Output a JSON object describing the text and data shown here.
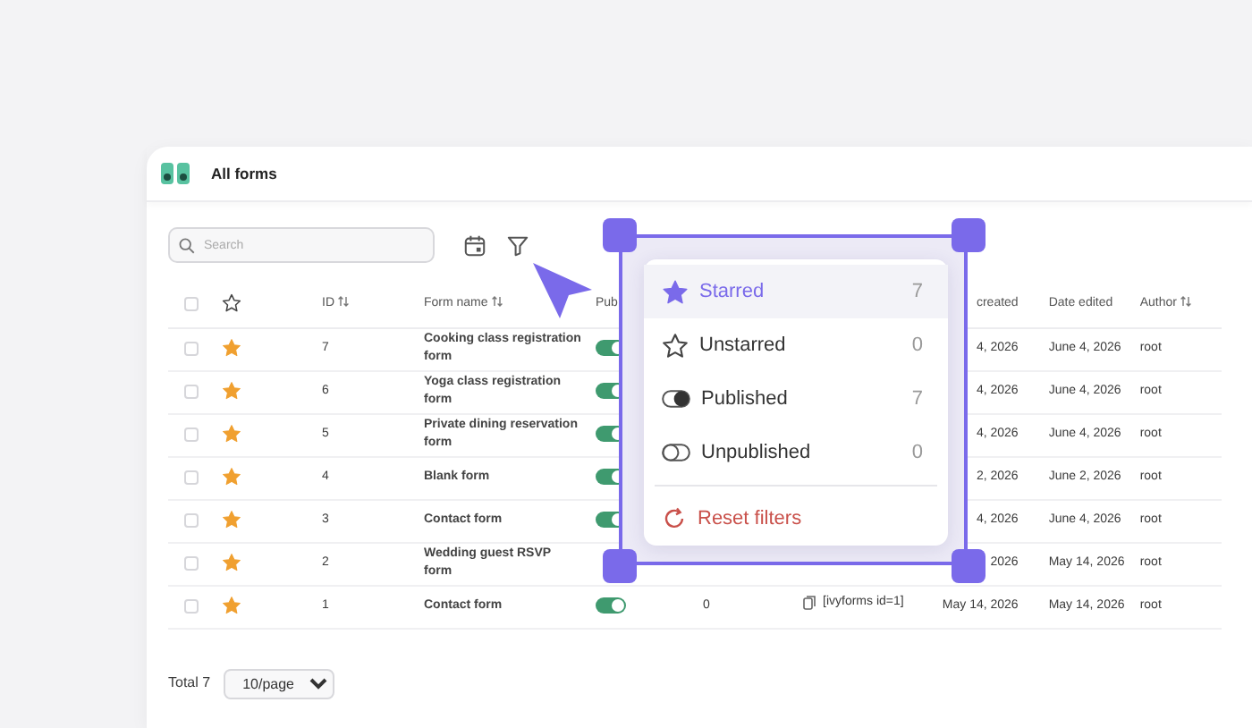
{
  "header": {
    "title": "All forms"
  },
  "toolbar": {
    "search": {
      "placeholder": "Search"
    }
  },
  "table": {
    "columns": [
      {
        "kind": "checkbox",
        "checked": false
      },
      {
        "kind": "star"
      },
      {
        "kind": "text",
        "label": "ID",
        "sortable": true
      },
      {
        "kind": "text",
        "label": "Form name",
        "sortable": true
      },
      {
        "kind": "text",
        "label": "Pub"
      },
      {
        "kind": "blank"
      },
      {
        "kind": "blank"
      },
      {
        "kind": "text",
        "label": "created"
      },
      {
        "kind": "text",
        "label": "Date edited"
      },
      {
        "kind": "text",
        "label": "Author",
        "sortable": true
      }
    ],
    "rows": [
      {
        "checked": false,
        "starred": true,
        "id": "7",
        "name": "Cooking class registration form",
        "published": true,
        "created": "4, 2026",
        "edited": "June 4, 2026",
        "author": "root"
      },
      {
        "checked": false,
        "starred": true,
        "id": "6",
        "name": "Yoga class registration form",
        "published": true,
        "created": "4, 2026",
        "edited": "June 4, 2026",
        "author": "root"
      },
      {
        "checked": false,
        "starred": true,
        "id": "5",
        "name": "Private dining reservation form",
        "published": true,
        "created": "4, 2026",
        "edited": "June 4, 2026",
        "author": "root"
      },
      {
        "checked": false,
        "starred": true,
        "id": "4",
        "name": "Blank form",
        "published": true,
        "created": "2, 2026",
        "edited": "June 2, 2026",
        "author": "root"
      },
      {
        "checked": false,
        "starred": true,
        "id": "3",
        "name": "Contact form",
        "published": true,
        "created": "4, 2026",
        "edited": "June 4, 2026",
        "author": "root"
      },
      {
        "checked": false,
        "starred": true,
        "id": "2",
        "name": "Wedding guest RSVP form",
        "created": "2026",
        "edited": "May 14, 2026",
        "author": "root"
      },
      {
        "checked": false,
        "starred": true,
        "id": "1",
        "name": "Contact form",
        "published": true,
        "entries": "0",
        "shortcode": "[ivyforms id=1]",
        "created": "May 14, 2026",
        "edited": "May 14, 2026",
        "author": "root"
      }
    ]
  },
  "pagination": {
    "total": "Total 7",
    "per_page": "10/page"
  },
  "filter_menu": {
    "items": [
      {
        "kind": "star-filled",
        "label": "Starred",
        "count": "7",
        "selected": true
      },
      {
        "kind": "star-outline",
        "label": "Unstarred",
        "count": "0",
        "selected": false
      },
      {
        "kind": "toggle-on",
        "label": "Published",
        "count": "7",
        "selected": false
      },
      {
        "kind": "toggle-off",
        "label": "Unpublished",
        "count": "0",
        "selected": false
      }
    ],
    "reset": {
      "label": "Reset filters"
    }
  }
}
